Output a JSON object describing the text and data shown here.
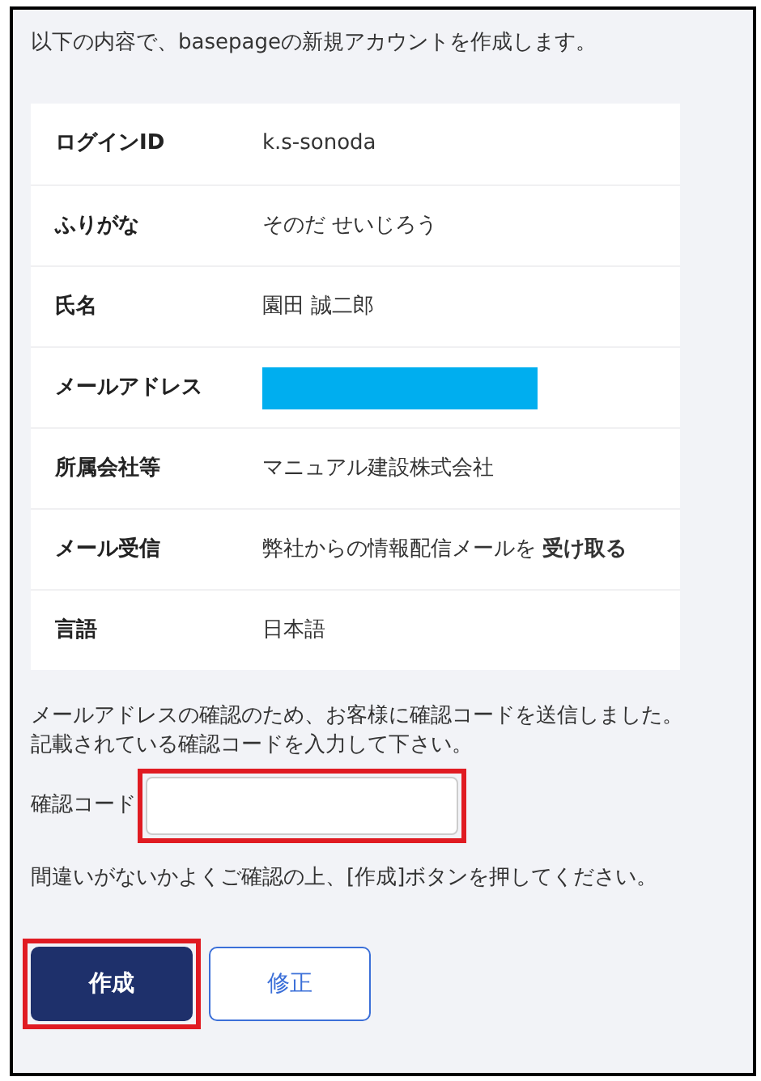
{
  "intro": "以下の内容で、basepageの新規アカウントを作成します。",
  "details": [
    {
      "kind": "text",
      "label": "ログインID",
      "value": "k.s-sonoda"
    },
    {
      "kind": "text",
      "label": "ふりがな",
      "value": "そのだ せいじろう"
    },
    {
      "kind": "text",
      "label": "氏名",
      "value": "園田 誠二郎"
    },
    {
      "kind": "redacted",
      "label": "メールアドレス"
    },
    {
      "kind": "text",
      "label": "所属会社等",
      "value": "マニュアル建設株式会社"
    },
    {
      "kind": "text",
      "label": "メール受信",
      "value": "弊社からの情報配信メールを **受け取る**"
    },
    {
      "kind": "text",
      "label": "言語",
      "value": "日本語"
    }
  ],
  "notice": [
    "メールアドレスの確認のため、お客様に確認コードを送信しました。",
    "記載されている確認コードを入力して下さい。"
  ],
  "code_field": {
    "label": "確認コード",
    "highlighted": true
  },
  "confirm_text": "間違いがないかよくご確認の上、[作成]ボタンを押してください。",
  "buttons": [
    {
      "kind": "primary",
      "label": "作成",
      "highlighted": true
    },
    {
      "kind": "secondary",
      "label": "修正",
      "highlighted": false
    }
  ]
}
